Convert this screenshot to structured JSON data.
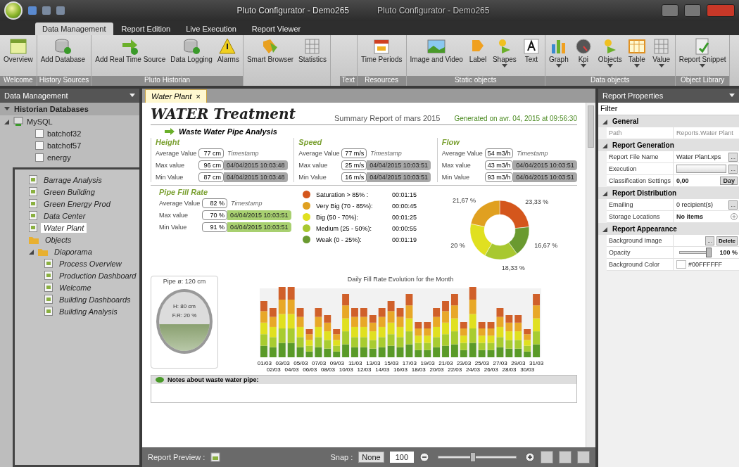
{
  "window": {
    "title": "Pluto Configurator - Demo265",
    "front_title": "Pluto Configurator - Demo265"
  },
  "ribbon": {
    "tabs": [
      {
        "label": "Data Management",
        "selected": true
      },
      {
        "label": "Report Edition",
        "selected": false
      },
      {
        "label": "Live Execution",
        "selected": false
      },
      {
        "label": "Report Viewer",
        "selected": false
      }
    ],
    "groups": [
      {
        "label": "Welcome",
        "items": [
          {
            "label": "Overview",
            "kind": "overview",
            "dropdown": false
          }
        ]
      },
      {
        "label": "History Sources",
        "items": [
          {
            "label": "Add Database",
            "kind": "database",
            "dropdown": false
          }
        ]
      },
      {
        "label": "Pluto Historian",
        "items": [
          {
            "label": "Add Real Time Source",
            "kind": "realtime",
            "dropdown": false
          },
          {
            "label": "Data Logging",
            "kind": "database",
            "dropdown": false
          },
          {
            "label": "Alarms",
            "kind": "alarm",
            "dropdown": false
          }
        ]
      },
      {
        "items": [
          {
            "label": "Smart Browser",
            "kind": "browser",
            "dropdown": false
          },
          {
            "label": "Statistics",
            "kind": "statistics",
            "dropdown": false
          }
        ]
      }
    ],
    "front_groups": [
      {
        "label": "Text"
      },
      {
        "label": "Resources",
        "items": [
          {
            "label": "Time Periods",
            "kind": "calendar",
            "dropdown": false
          }
        ]
      },
      {
        "label": "Static objects",
        "items": [
          {
            "label": "Image and Video",
            "kind": "image",
            "dropdown": false
          },
          {
            "label": "Label",
            "kind": "label",
            "dropdown": false
          },
          {
            "label": "Shapes",
            "kind": "shapes",
            "dropdown": true
          },
          {
            "label": "Text",
            "kind": "text",
            "dropdown": false
          }
        ]
      },
      {
        "label": "Data objects",
        "items": [
          {
            "label": "Graph",
            "kind": "graph",
            "dropdown": true
          },
          {
            "label": "Kpi",
            "kind": "kpi",
            "dropdown": true
          },
          {
            "label": "Objects",
            "kind": "shapes",
            "dropdown": true
          },
          {
            "label": "Table",
            "kind": "table",
            "dropdown": true
          },
          {
            "label": "Value",
            "kind": "statistics",
            "dropdown": true
          }
        ]
      },
      {
        "label": "Object Library",
        "items": [
          {
            "label": "Report Snippet",
            "kind": "snippet",
            "dropdown": true
          }
        ]
      }
    ]
  },
  "data_panel": {
    "title": "Data Management",
    "section": "Historian Databases",
    "tree": [
      {
        "label": "MySQL",
        "kind": "server",
        "expanded": true,
        "children": [
          {
            "label": "batchof32",
            "kind": "table"
          },
          {
            "label": "batchof57",
            "kind": "table"
          },
          {
            "label": "energy",
            "kind": "table"
          }
        ]
      }
    ]
  },
  "explorer": {
    "tree": [
      {
        "label": "Barrage Analysis",
        "kind": "report",
        "selected": false
      },
      {
        "label": "Green Building",
        "kind": "report",
        "selected": false
      },
      {
        "label": "Green Energy Prod",
        "kind": "report",
        "selected": false
      },
      {
        "label": "Data Center",
        "kind": "report",
        "selected": false
      },
      {
        "label": "Water Plant",
        "kind": "report",
        "selected": true
      },
      {
        "label": "Objects",
        "kind": "folder",
        "selected": false
      },
      {
        "label": "Diaporama",
        "kind": "folder",
        "selected": false,
        "children": [
          {
            "label": "Process Overview",
            "kind": "report",
            "selected": false
          },
          {
            "label": "Production Dashboard",
            "kind": "report",
            "selected": false
          },
          {
            "label": "Welcome",
            "kind": "report",
            "selected": false
          },
          {
            "label": "Building Dashboards",
            "kind": "report",
            "selected": false
          },
          {
            "label": "Building Analysis",
            "kind": "report",
            "selected": false
          }
        ]
      }
    ]
  },
  "document_tab": {
    "label": "Water Plant",
    "close": "×"
  },
  "report": {
    "title": "WATER Treatment",
    "subtitle": "Summary Report of mars 2015",
    "generated": "Generated on avr. 04, 2015 at 09:56:30",
    "section": "Waste Water Pipe Analysis",
    "measures": [
      {
        "title": "Height",
        "kind": "plain",
        "avg_label": "Average Value",
        "avg": "77 cm",
        "ts_label": "Timestamp",
        "rows": [
          {
            "label": "Max value",
            "value": "96 cm",
            "time": "04/04/2015 10:03:48"
          },
          {
            "label": "Min Value",
            "value": "87 cm",
            "time": "04/04/2015 10:03:48"
          }
        ]
      },
      {
        "title": "Speed",
        "kind": "plain",
        "avg_label": "Average Value",
        "avg": "77 m/s",
        "ts_label": "Timestamp",
        "rows": [
          {
            "label": "Max value",
            "value": "25 m/s",
            "time": "04/04/2015 10:03:51"
          },
          {
            "label": "Min Value",
            "value": "16 m/s",
            "time": "04/04/2015 10:03:51"
          }
        ]
      },
      {
        "title": "Flow",
        "kind": "plain",
        "avg_label": "Average Value",
        "avg": "54 m3/h",
        "ts_label": "Timestamp",
        "rows": [
          {
            "label": "Max value",
            "value": "43 m3/h",
            "time": "04/04/2015 10:03:51"
          },
          {
            "label": "Min Value",
            "value": "93 m3/h",
            "time": "04/04/2015 10:03:51"
          }
        ]
      }
    ],
    "fill_rate": {
      "title": "Pipe Fill Rate",
      "kind": "highlighted",
      "avg_label": "Average Value",
      "avg": "82 %",
      "ts_label": "Timestamp",
      "rows": [
        {
          "label": "Max value",
          "value": "70 %",
          "time": "04/04/2015 10:03:51"
        },
        {
          "label": "Min Value",
          "value": "91 %",
          "time": "04/04/2015 10:03:51"
        }
      ]
    },
    "legend": [
      {
        "label": "Saturation > 85% :",
        "time": "00:01:15",
        "color": "#d4561c"
      },
      {
        "label": "Very Big (70 - 85%):",
        "time": "00:00:45",
        "color": "#e0a020"
      },
      {
        "label": "Big (50 - 70%):",
        "time": "00:01:25",
        "color": "#e0e020"
      },
      {
        "label": "Medium (25 - 50%):",
        "time": "00:00:55",
        "color": "#a8c830"
      },
      {
        "label": "Weak (0 - 25%):",
        "time": "00:01:19",
        "color": "#6a9a30"
      }
    ],
    "donut": {
      "chart_data": {
        "type": "donut",
        "values": [
          23.33,
          21.67,
          20,
          18.33,
          16.67
        ],
        "value_labels": [
          "23,33 %",
          "21,67 %",
          "20 %",
          "18,33 %",
          "16,67 %"
        ]
      }
    },
    "pipe": {
      "diameter": "Pipe ø: 120 cm",
      "height": "H: 80 cm",
      "fill": "F.R: 20 %",
      "level": 0.45
    },
    "bar_chart": {
      "title": "Daily Fill Rate Evolution for the Month",
      "x_labels": [
        "01/03",
        "02/03",
        "03/03",
        "04/03",
        "05/03",
        "06/03",
        "07/03",
        "08/03",
        "09/03",
        "10/03",
        "11/03",
        "12/03",
        "13/03",
        "14/03",
        "15/03",
        "16/03",
        "17/03",
        "18/03",
        "19/03",
        "20/03",
        "21/03",
        "22/03",
        "23/03",
        "24/03",
        "25/03",
        "26/03",
        "27/03",
        "28/03",
        "29/03",
        "30/03",
        "31/03"
      ]
    },
    "notes": "Notes about waste water pipe:"
  },
  "status_bar": {
    "preview": "Report Preview :",
    "snap_label": "Snap :",
    "snap": "None",
    "zoom": "100",
    "zoom_slider": {
      "level": 0.45
    }
  },
  "properties": {
    "title": "Report Properties",
    "filter": "Filter",
    "categories": [
      {
        "name": "General",
        "rows": [
          {
            "name": "Path",
            "kind": "readonly",
            "value": "Reports.Water Plant"
          }
        ]
      },
      {
        "name": "Report Generation",
        "rows": [
          {
            "name": "Report File Name",
            "kind": "button",
            "value": "Water Plant.xps",
            "button": "..."
          },
          {
            "name": "Execution",
            "kind": "combo",
            "button": "..."
          },
          {
            "name": "Classification Settings",
            "kind": "spin",
            "value": "0,00",
            "unit": "Day"
          }
        ]
      },
      {
        "name": "Report Distribution",
        "rows": [
          {
            "name": "Emailing",
            "kind": "button",
            "value": "0 recipient(s)",
            "button": "..."
          },
          {
            "name": "Storage Locations",
            "kind": "items",
            "value": "No items"
          }
        ]
      },
      {
        "name": "Report Appearance",
        "rows": [
          {
            "name": "Background Image",
            "kind": "image",
            "button": "...",
            "action": "Delete"
          },
          {
            "name": "Opacity",
            "kind": "slider",
            "level": 1,
            "value": "100 %"
          },
          {
            "name": "Background Color",
            "kind": "color",
            "value": "#00FFFFFF"
          }
        ]
      }
    ]
  }
}
